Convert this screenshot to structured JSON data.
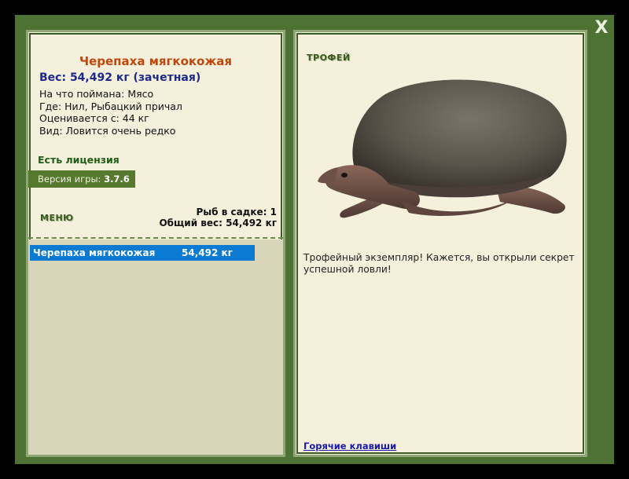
{
  "close": {
    "label": "X"
  },
  "fish": {
    "title": "Черепаха мягкокожая",
    "weight_line": "Вес: 54,492 кг (зачетная)",
    "details": [
      "На что поймана: Мясо",
      "Где: Нил, Рыбацкий причал",
      "Оценивается с: 44 кг",
      "Вид: Ловится очень редко"
    ]
  },
  "license": "Есть лицензия",
  "version": {
    "label": "Версия игры:",
    "value": "3.7.6"
  },
  "menu_label": "МЕНЮ",
  "cage": {
    "count_line": "Рыб в садке: 1",
    "total_line": "Общий вес: 54,492 кг"
  },
  "catch_list": [
    {
      "name": "Черепаха мягкокожая",
      "weight": "54,492 кг"
    }
  ],
  "trophy_label": "ТРОФЕЙ",
  "description": "Трофейный экземпляр! Кажется, вы открыли секрет успешной ловли!",
  "hotkeys_label": "Горячие клавиши",
  "colors": {
    "frame": "#4e7233",
    "panel": "#f4f0dc",
    "title": "#c0470c",
    "weight": "#1c2a8a",
    "selection": "#0a7ad2"
  }
}
